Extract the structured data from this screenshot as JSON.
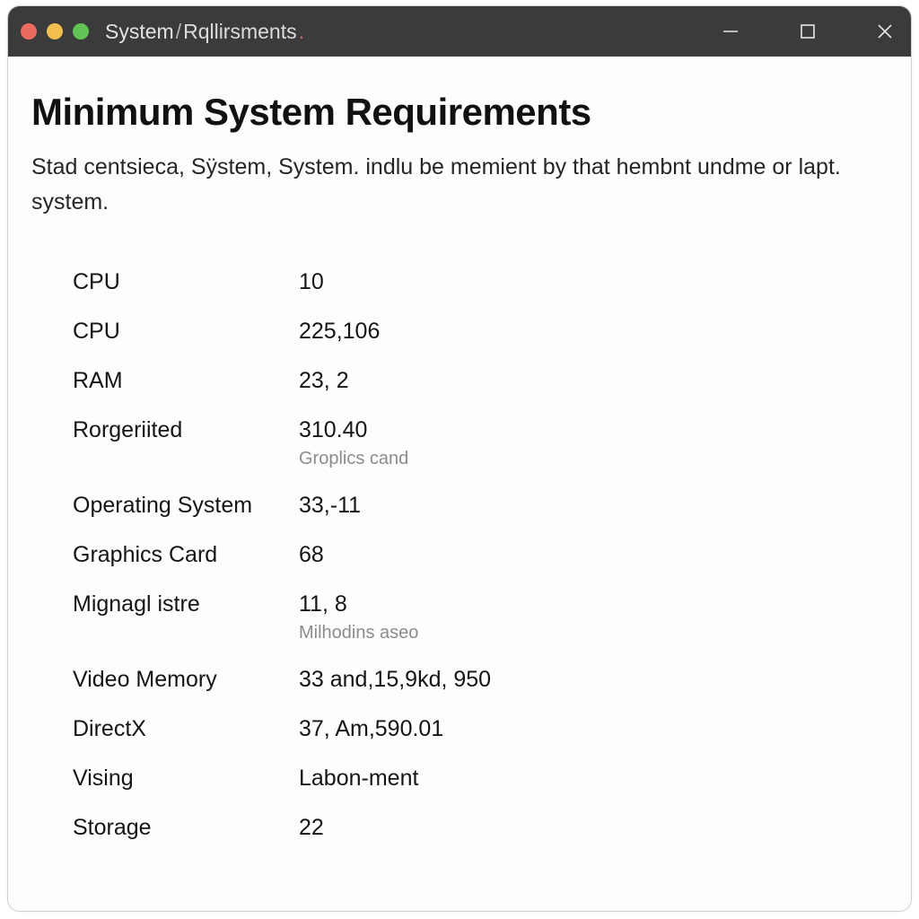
{
  "window": {
    "title_seg1": "System",
    "title_sep": "/",
    "title_seg2": "Rqllirsments",
    "title_dot": "."
  },
  "page": {
    "heading": "Minimum System Requirements",
    "subtitle": "Stad centsieca, Sÿstem, System. indlu be memient by that hembnt undme or lapt. system."
  },
  "specs": [
    {
      "label": "CPU",
      "value": "10"
    },
    {
      "label": "CPU",
      "value": "225,106"
    },
    {
      "label": "RAM",
      "value": "23, 2"
    },
    {
      "label": "Rorgeriited",
      "value": "310.40",
      "sub": "Groplics cand"
    },
    {
      "label": "Operating System",
      "value": "33,-11"
    },
    {
      "label": "Graphics Card",
      "value": "68"
    },
    {
      "label": "Mignagl istre",
      "value": "11, 8",
      "sub": "Milhodins aseo"
    },
    {
      "label": "Video Memory",
      "value": "33 and,15,9kd, 950"
    },
    {
      "label": "DirectX",
      "value": "37, Am,590.01"
    },
    {
      "label": "Vising",
      "value": "Labon-ment"
    },
    {
      "label": "Storage",
      "value": "22"
    }
  ]
}
